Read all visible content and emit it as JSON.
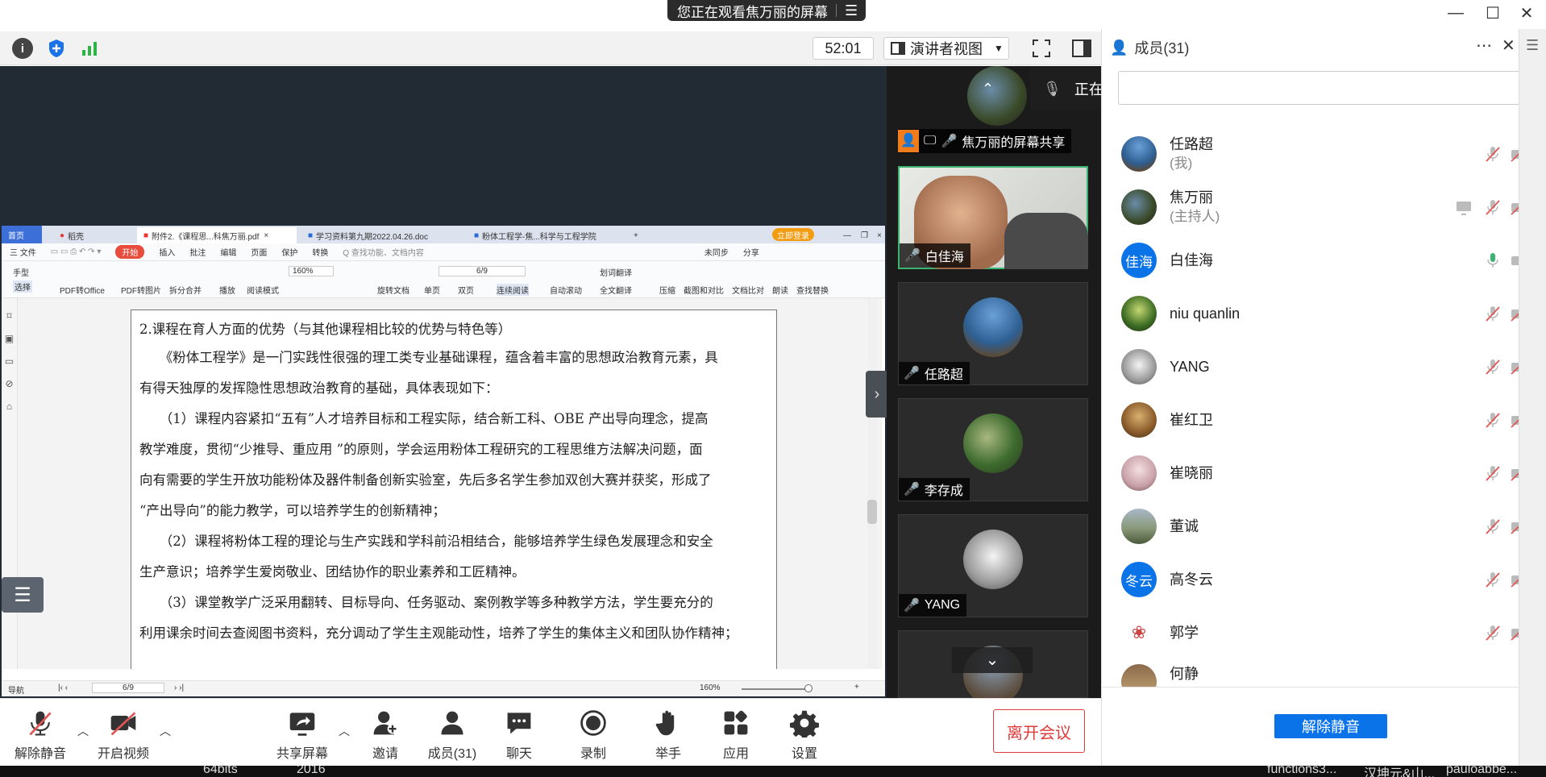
{
  "title_bar": {
    "share_banner": "您正在观看焦万丽的屏幕",
    "menu_icon": "list-icon"
  },
  "toolbar": {
    "timer": "52:01",
    "view_mode": "演讲者视图"
  },
  "doc_window": {
    "tabs": [
      "首页",
      "稻壳",
      "附件2.《课程思...科焦万丽.pdf",
      "学习资料第九期2022.04.26.doc",
      "粉体工程学-焦...科学与工程学院"
    ],
    "login_button": "立即登录",
    "menu": [
      "三 文件",
      "开始",
      "插入",
      "批注",
      "编辑",
      "页面",
      "保护",
      "转换"
    ],
    "search_placeholder": "Q 查找功能、文档内容",
    "menu_right": [
      "未同步",
      "分享"
    ],
    "ribbon": {
      "tools": [
        "手型",
        "选择",
        "PDF转Office",
        "PDF转图片",
        "拆分合并",
        "播放",
        "阅读模式",
        "旋转文档",
        "单页",
        "双页",
        "连续阅读",
        "自动滚动",
        "划词翻译",
        "全文翻译",
        "压缩",
        "截图和对比",
        "文档比对",
        "朗读",
        "查找替换"
      ],
      "zoom": "160%",
      "page": "6/9"
    },
    "status": {
      "nav": "导航",
      "page": "6/9",
      "zoom": "160%"
    },
    "page_lines": [
      "2.课程在育人方面的优势（与其他课程相比较的优势与特色等）",
      "　　《粉体工程学》是一门实践性很强的理工类专业基础课程，蕴含着丰富的思想政治教育元素，具",
      "有得天独厚的发挥隐性思想政治教育的基础，具体表现如下：",
      "　　（1）课程内容紧扣“五有”人才培养目标和工程实际，结合新工科、OBE 产出导向理念，提高",
      "教学难度，贯彻“少推导、重应用 ”的原则，学会运用粉体工程研究的工程思维方法解决问题，面",
      "向有需要的学生开放功能粉体及器件制备创新实验室，先后多名学生参加双创大赛并获奖，形成了",
      "“产出导向”的能力教学，可以培养学生的创新精神；",
      "　　（2）课程将粉体工程的理论与生产实践和学科前沿相结合，能够培养学生绿色发展理念和安全",
      "生产意识；培养学生爱岗敬业、团结协作的职业素养和工匠精神。",
      "　　（3）课堂教学广泛采用翻转、目标导向、任务驱动、案例教学等多种教学方法，学生要充分的",
      "利用课余时间去查阅图书资料，充分调动了学生主观能动性，培养了学生的集体主义和团队协作精神；"
    ]
  },
  "video_tiles": [
    {
      "name": "焦万丽的屏幕共享"
    },
    {
      "name": "白佳海"
    },
    {
      "name": "任路超"
    },
    {
      "name": "李存成"
    },
    {
      "name": "YANG"
    }
  ],
  "speaking": {
    "text": "正在讲话: 白佳海;"
  },
  "members_panel": {
    "title": "成员(31)",
    "members": [
      {
        "name": "任路超",
        "sub": "(我)"
      },
      {
        "name": "焦万丽",
        "sub": "(主持人)"
      },
      {
        "name": "白佳海",
        "avatar_text": "佳海"
      },
      {
        "name": "niu quanlin"
      },
      {
        "name": "YANG"
      },
      {
        "name": "崔红卫"
      },
      {
        "name": "崔晓丽"
      },
      {
        "name": "董诚"
      },
      {
        "name": "高冬云",
        "avatar_text": "冬云"
      },
      {
        "name": "郭学"
      },
      {
        "name": "何静"
      }
    ],
    "unmute_all": "解除静音"
  },
  "bottom_bar": {
    "unmute": "解除静音",
    "start_video": "开启视频",
    "share_screen": "共享屏幕",
    "invite": "邀请",
    "members": "成员(31)",
    "chat": "聊天",
    "record": "录制",
    "raise_hand": "举手",
    "apps": "应用",
    "settings": "设置",
    "leave": "离开会议"
  },
  "taskbar": [
    "64bits",
    "2016",
    "functions3...",
    "汉坤元&山...",
    "pauloabbe..."
  ],
  "colors": {
    "accent_blue": "#0b73e8",
    "leave_red": "#e03b3b",
    "speaking_green": "#3cb371",
    "muted_red": "#e05555"
  }
}
